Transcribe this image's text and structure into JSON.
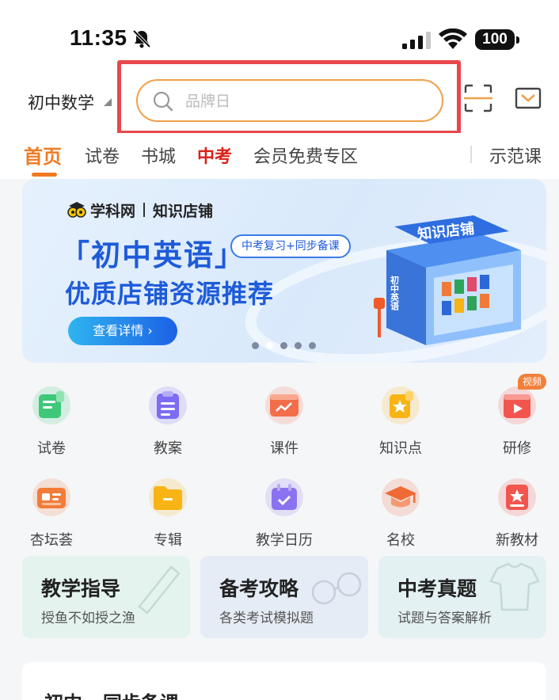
{
  "status_bar": {
    "time": "11:35",
    "battery": "100"
  },
  "header": {
    "subject": "初中数学",
    "search_placeholder": "品牌日"
  },
  "tabs": [
    {
      "label": "首页",
      "active": true
    },
    {
      "label": "试卷"
    },
    {
      "label": "书城"
    },
    {
      "label": "中考",
      "highlight": true
    },
    {
      "label": "会员免费专区"
    },
    {
      "label": "示范课"
    }
  ],
  "banner": {
    "brand_name": "学科网",
    "brand_sub": "知识店铺",
    "title": "「初中英语」",
    "tag": "中考复习+同步备课",
    "subtitle": "优质店铺资源推荐",
    "button": "查看详情 ›",
    "store_sign": "知识店铺",
    "store_side": "初中英语",
    "page_count": 5,
    "active_page": 2
  },
  "grid": [
    {
      "label": "试卷",
      "icon": "test-paper-icon",
      "color": "#3fc77a"
    },
    {
      "label": "教案",
      "icon": "clipboard-icon",
      "color": "#7b6cf2"
    },
    {
      "label": "课件",
      "icon": "slides-icon",
      "color": "#f36d4b"
    },
    {
      "label": "知识点",
      "icon": "star-bookmark-icon",
      "color": "#f7b414"
    },
    {
      "label": "研修",
      "icon": "video-play-icon",
      "color": "#f2554d",
      "badge": "视频"
    },
    {
      "label": "杏坛荟",
      "icon": "id-card-icon",
      "color": "#f27c3a"
    },
    {
      "label": "专辑",
      "icon": "folder-icon",
      "color": "#f7b414"
    },
    {
      "label": "教学日历",
      "icon": "calendar-icon",
      "color": "#8a72f0"
    },
    {
      "label": "名校",
      "icon": "graduation-cap-icon",
      "color": "#f06a35"
    },
    {
      "label": "新教材",
      "icon": "book-star-icon",
      "color": "#f2554d"
    }
  ],
  "cards": [
    {
      "title": "教学指导",
      "subtitle": "授鱼不如授之渔",
      "bg": "#e4f3ee"
    },
    {
      "title": "备考攻略",
      "subtitle": "各类考试模拟题",
      "bg": "#e6ecf5"
    },
    {
      "title": "中考真题",
      "subtitle": "试题与答案解析",
      "bg": "#e4f1f2"
    }
  ],
  "bottom": {
    "title": "初中 · 同步备课"
  }
}
